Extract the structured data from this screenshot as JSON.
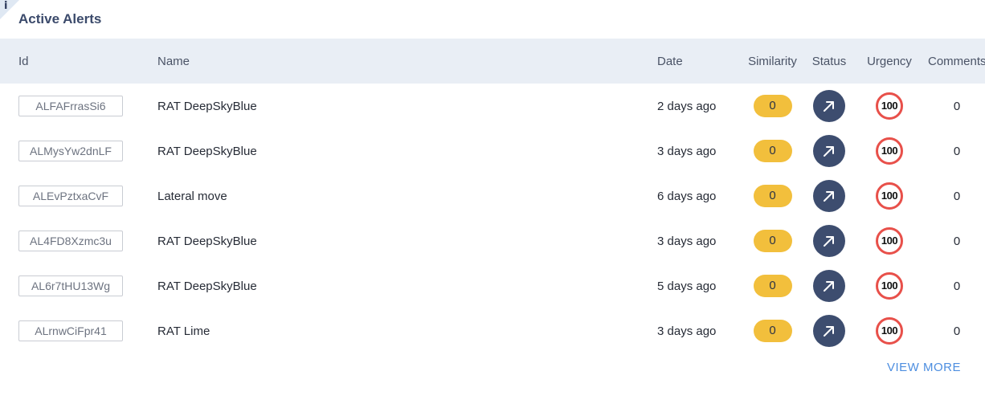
{
  "badge": {
    "glyph": "i"
  },
  "panel": {
    "title": "Active Alerts"
  },
  "table": {
    "headers": {
      "id": "Id",
      "name": "Name",
      "date": "Date",
      "similarity": "Similarity",
      "status": "Status",
      "urgency": "Urgency",
      "comments": "Comments"
    },
    "rows": [
      {
        "id": "ALFAFrrasSi6",
        "name": "RAT DeepSkyBlue",
        "date": "2 days ago",
        "similarity": "0",
        "urgency": "100",
        "comments": "0"
      },
      {
        "id": "ALMysYw2dnLF",
        "name": "RAT DeepSkyBlue",
        "date": "3 days ago",
        "similarity": "0",
        "urgency": "100",
        "comments": "0"
      },
      {
        "id": "ALEvPztxaCvF",
        "name": "Lateral move",
        "date": "6 days ago",
        "similarity": "0",
        "urgency": "100",
        "comments": "0"
      },
      {
        "id": "AL4FD8Xzmc3u",
        "name": "RAT DeepSkyBlue",
        "date": "3 days ago",
        "similarity": "0",
        "urgency": "100",
        "comments": "0"
      },
      {
        "id": "AL6r7tHU13Wg",
        "name": "RAT DeepSkyBlue",
        "date": "5 days ago",
        "similarity": "0",
        "urgency": "100",
        "comments": "0"
      },
      {
        "id": "ALrnwCiFpr41",
        "name": "RAT Lime",
        "date": "3 days ago",
        "similarity": "0",
        "urgency": "100",
        "comments": "0"
      }
    ]
  },
  "footer": {
    "view_more": "VIEW MORE"
  },
  "icons": {
    "status": "arrow-up-right-icon"
  },
  "colors": {
    "similarity_pill": "#f2bf3c",
    "status_button": "#3d4d6f",
    "urgency_ring": "#e8504a",
    "link": "#4d8ee0",
    "header_bg": "#e9eef5"
  }
}
